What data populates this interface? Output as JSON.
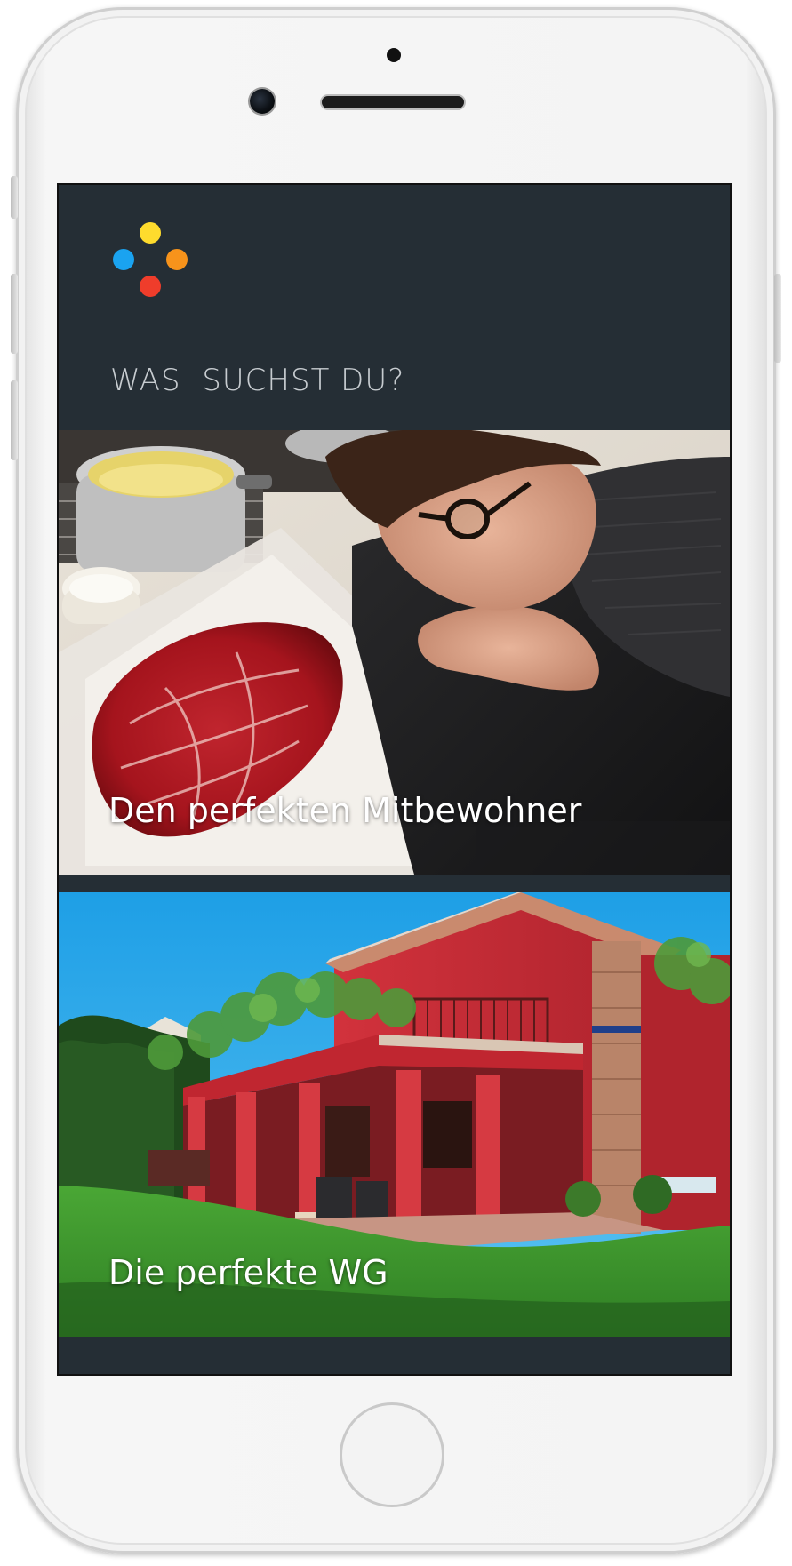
{
  "app": {
    "logo_colors": {
      "top": "#fedb2d",
      "left": "#1aa3f0",
      "right": "#f7931b",
      "bottom": "#ef3d2b"
    },
    "title": "WAS  SUCHST DU?"
  },
  "cards": [
    {
      "label": "Den perfekten Mitbewohner",
      "image": "person-resting-beside-raw-meat-photo"
    },
    {
      "label": "Die perfekte WG",
      "image": "red-villa-with-garden-photo"
    }
  ],
  "colors": {
    "screen_background": "#252e35",
    "title_text": "#c7ccd0",
    "card_label": "#ffffff"
  }
}
